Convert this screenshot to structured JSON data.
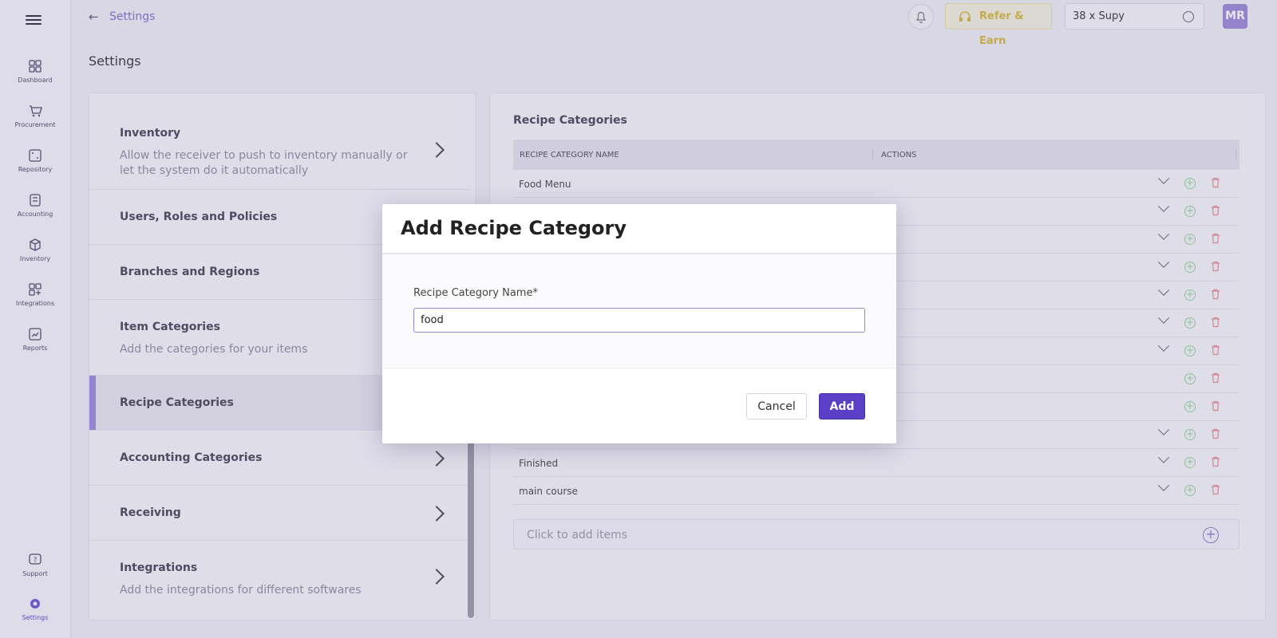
{
  "sidebar": {
    "items": [
      {
        "label": "Dashboard",
        "icon": "dashboard-icon"
      },
      {
        "label": "Procurement",
        "icon": "cart-icon"
      },
      {
        "label": "Repository",
        "icon": "repository-icon"
      },
      {
        "label": "Accounting",
        "icon": "calculator-icon"
      },
      {
        "label": "Inventory",
        "icon": "box-icon"
      },
      {
        "label": "Integrations",
        "icon": "integrations-icon"
      },
      {
        "label": "Reports",
        "icon": "reports-icon"
      },
      {
        "label": "Support",
        "icon": "help-icon"
      },
      {
        "label": "Settings",
        "icon": "gear-icon"
      }
    ]
  },
  "header": {
    "breadcrumb": "Settings",
    "refer_label": "Refer & Earn",
    "branch": "38 x Supy",
    "avatar_initials": "MR"
  },
  "page_title": "Settings",
  "settings_menu": [
    {
      "title": "Inventory",
      "desc": "Allow the receiver to push to inventory manually or let the system do it automatically"
    },
    {
      "title": "Users, Roles and Policies",
      "desc": ""
    },
    {
      "title": "Branches and Regions",
      "desc": ""
    },
    {
      "title": "Item Categories",
      "desc": "Add the categories for your items"
    },
    {
      "title": "Recipe Categories",
      "desc": ""
    },
    {
      "title": "Accounting Categories",
      "desc": ""
    },
    {
      "title": "Receiving",
      "desc": ""
    },
    {
      "title": "Integrations",
      "desc": "Add the integrations for different softwares"
    }
  ],
  "recipe_panel": {
    "title": "Recipe Categories",
    "col_name": "RECIPE CATEGORY NAME",
    "col_actions": "ACTIONS",
    "rows": [
      "Food Menu",
      "",
      "",
      "",
      "",
      "",
      "",
      "",
      "",
      "",
      "Finished",
      "main course"
    ],
    "add_items": "Click to add items"
  },
  "modal": {
    "title": "Add Recipe Category",
    "field_label": "Recipe Category Name*",
    "field_value": "food",
    "cancel_label": "Cancel",
    "add_label": "Add"
  },
  "colors": {
    "accent": "#5b3fc6",
    "refer": "#d4b63c",
    "add_icon": "#8fd39b",
    "delete_icon": "#e48a94"
  }
}
